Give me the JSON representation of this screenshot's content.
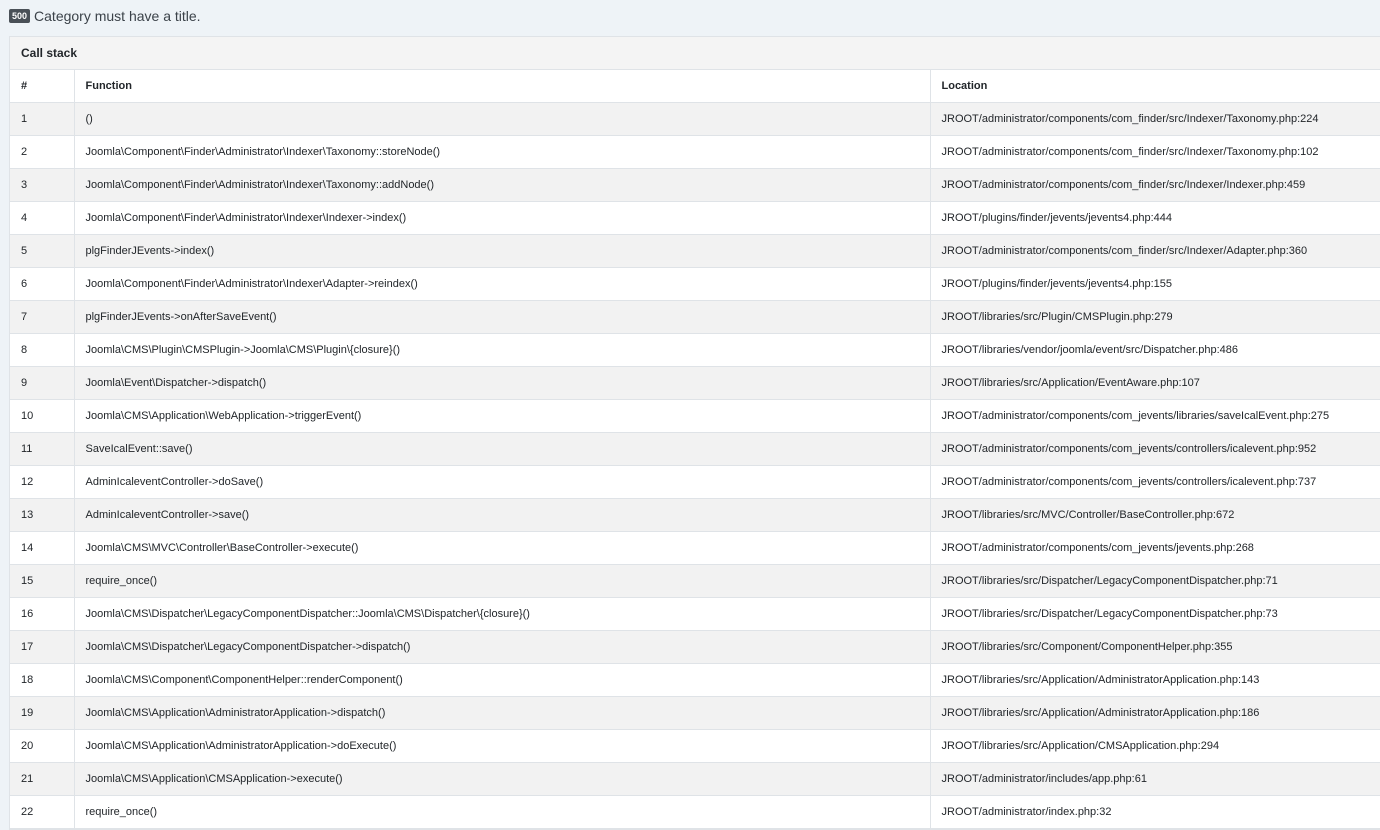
{
  "error": {
    "code": "500",
    "message": "Category must have a title."
  },
  "call_stack": {
    "title": "Call stack",
    "columns": [
      "#",
      "Function",
      "Location"
    ],
    "rows": [
      {
        "num": "1",
        "func": "()",
        "loc": "JROOT/administrator/components/com_finder/src/Indexer/Taxonomy.php:224"
      },
      {
        "num": "2",
        "func": "Joomla\\Component\\Finder\\Administrator\\Indexer\\Taxonomy::storeNode()",
        "loc": "JROOT/administrator/components/com_finder/src/Indexer/Taxonomy.php:102"
      },
      {
        "num": "3",
        "func": "Joomla\\Component\\Finder\\Administrator\\Indexer\\Taxonomy::addNode()",
        "loc": "JROOT/administrator/components/com_finder/src/Indexer/Indexer.php:459"
      },
      {
        "num": "4",
        "func": "Joomla\\Component\\Finder\\Administrator\\Indexer\\Indexer->index()",
        "loc": "JROOT/plugins/finder/jevents/jevents4.php:444"
      },
      {
        "num": "5",
        "func": "plgFinderJEvents->index()",
        "loc": "JROOT/administrator/components/com_finder/src/Indexer/Adapter.php:360"
      },
      {
        "num": "6",
        "func": "Joomla\\Component\\Finder\\Administrator\\Indexer\\Adapter->reindex()",
        "loc": "JROOT/plugins/finder/jevents/jevents4.php:155"
      },
      {
        "num": "7",
        "func": "plgFinderJEvents->onAfterSaveEvent()",
        "loc": "JROOT/libraries/src/Plugin/CMSPlugin.php:279"
      },
      {
        "num": "8",
        "func": "Joomla\\CMS\\Plugin\\CMSPlugin->Joomla\\CMS\\Plugin\\{closure}()",
        "loc": "JROOT/libraries/vendor/joomla/event/src/Dispatcher.php:486"
      },
      {
        "num": "9",
        "func": "Joomla\\Event\\Dispatcher->dispatch()",
        "loc": "JROOT/libraries/src/Application/EventAware.php:107"
      },
      {
        "num": "10",
        "func": "Joomla\\CMS\\Application\\WebApplication->triggerEvent()",
        "loc": "JROOT/administrator/components/com_jevents/libraries/saveIcalEvent.php:275"
      },
      {
        "num": "11",
        "func": "SaveIcalEvent::save()",
        "loc": "JROOT/administrator/components/com_jevents/controllers/icalevent.php:952"
      },
      {
        "num": "12",
        "func": "AdminIcaleventController->doSave()",
        "loc": "JROOT/administrator/components/com_jevents/controllers/icalevent.php:737"
      },
      {
        "num": "13",
        "func": "AdminIcaleventController->save()",
        "loc": "JROOT/libraries/src/MVC/Controller/BaseController.php:672"
      },
      {
        "num": "14",
        "func": "Joomla\\CMS\\MVC\\Controller\\BaseController->execute()",
        "loc": "JROOT/administrator/components/com_jevents/jevents.php:268"
      },
      {
        "num": "15",
        "func": "require_once()",
        "loc": "JROOT/libraries/src/Dispatcher/LegacyComponentDispatcher.php:71"
      },
      {
        "num": "16",
        "func": "Joomla\\CMS\\Dispatcher\\LegacyComponentDispatcher::Joomla\\CMS\\Dispatcher\\{closure}()",
        "loc": "JROOT/libraries/src/Dispatcher/LegacyComponentDispatcher.php:73"
      },
      {
        "num": "17",
        "func": "Joomla\\CMS\\Dispatcher\\LegacyComponentDispatcher->dispatch()",
        "loc": "JROOT/libraries/src/Component/ComponentHelper.php:355"
      },
      {
        "num": "18",
        "func": "Joomla\\CMS\\Component\\ComponentHelper::renderComponent()",
        "loc": "JROOT/libraries/src/Application/AdministratorApplication.php:143"
      },
      {
        "num": "19",
        "func": "Joomla\\CMS\\Application\\AdministratorApplication->dispatch()",
        "loc": "JROOT/libraries/src/Application/AdministratorApplication.php:186"
      },
      {
        "num": "20",
        "func": "Joomla\\CMS\\Application\\AdministratorApplication->doExecute()",
        "loc": "JROOT/libraries/src/Application/CMSApplication.php:294"
      },
      {
        "num": "21",
        "func": "Joomla\\CMS\\Application\\CMSApplication->execute()",
        "loc": "JROOT/administrator/includes/app.php:61"
      },
      {
        "num": "22",
        "func": "require_once()",
        "loc": "JROOT/administrator/index.php:32"
      }
    ]
  }
}
